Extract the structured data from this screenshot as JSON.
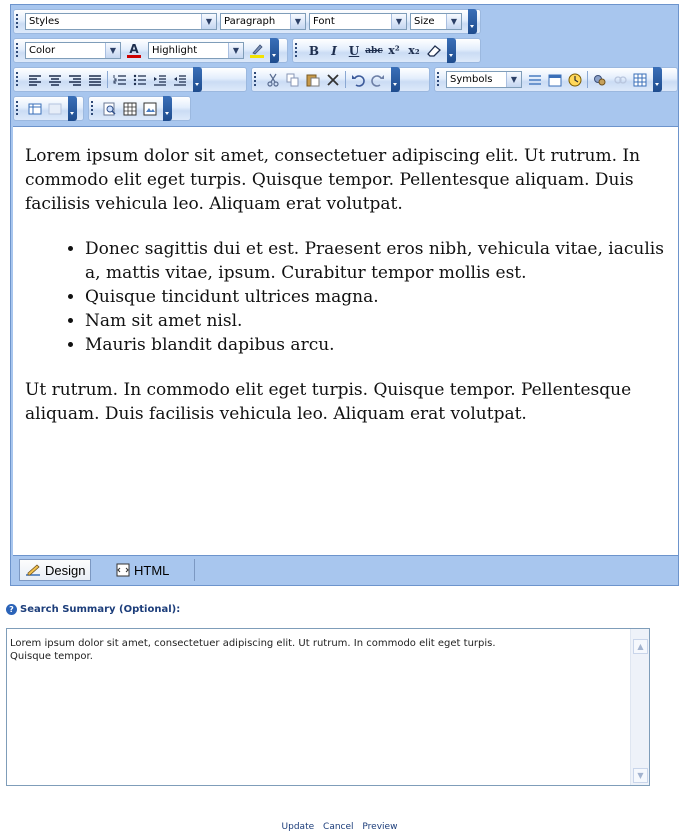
{
  "toolbar": {
    "row1": {
      "styles": "Styles",
      "paragraph": "Paragraph",
      "font": "Font",
      "size": "Size"
    },
    "row2": {
      "color": "Color",
      "color_letter": "A",
      "highlight": "Highlight",
      "bold": "B",
      "italic": "I",
      "underline": "U",
      "strike": "abc",
      "superscript": "x²",
      "subscript": "x₂",
      "font_color_accent": "#cc0000",
      "highlight_accent": "#f2e200"
    },
    "row3": {
      "symbols": "Symbols"
    }
  },
  "content": {
    "para1": "Lorem ipsum dolor sit amet, consectetuer adipiscing elit. Ut rutrum. In commodo elit eget turpis. Quisque tempor. Pellentesque aliquam. Duis facilisis vehicula leo. Aliquam erat volutpat.",
    "list": [
      "Donec sagittis dui et est. Praesent eros nibh, vehicula vitae, iaculis a, mattis vitae, ipsum. Curabitur tempor mollis est.",
      "Quisque tincidunt ultrices magna.",
      "Nam sit amet nisl.",
      "Mauris blandit dapibus arcu."
    ],
    "para2": "Ut rutrum. In commodo elit eget turpis. Quisque tempor. Pellentesque aliquam. Duis facilisis vehicula leo. Aliquam erat volutpat."
  },
  "modes": {
    "design": "Design",
    "html": "HTML"
  },
  "summary": {
    "label": "Search Summary (Optional):",
    "text": "Lorem ipsum dolor sit amet, consectetuer adipiscing elit. Ut rutrum. In commodo elit eget turpis.\nQuisque tempor."
  },
  "actions": {
    "update": "Update",
    "cancel": "Cancel",
    "preview": "Preview"
  },
  "colors": {
    "toolbar_bg": "#a8c6ee",
    "link": "#1c3d7a"
  }
}
